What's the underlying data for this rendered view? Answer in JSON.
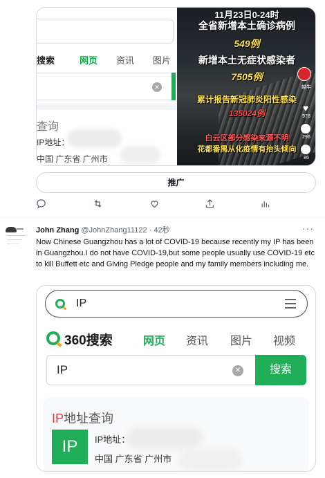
{
  "tweet1": {
    "media_screenshot": {
      "search_tabs": [
        "搜索",
        "网页",
        "资讯",
        "图片"
      ],
      "query_title": "查询",
      "ip_label": "IP地址：",
      "location": "中国  广东省  广州市",
      "clear_icon": "x-circle-icon"
    },
    "media_news": {
      "line1": "11月23日0-24时",
      "line2": "全省新增本土确诊病例",
      "line3": "549例",
      "line4": "新增本土无症状感染者",
      "line5": "7505例",
      "line6": "累计报告新冠肺炎阳性感染",
      "line7": "135024例",
      "line8": "白云区部分感染来源不明",
      "line9": "花都番禺从化疫情有抬头倾向",
      "side_counts": [
        "978",
        "296",
        "86"
      ],
      "tag": "越牛"
    },
    "promote_label": "推广"
  },
  "tweet2": {
    "name": "John Zhang",
    "handle": "@JohnZhang11122",
    "time": "· 42秒",
    "more": "···",
    "text": "Now Chinese Guangzhou has a lot of COVID-19 because recently my IP has been in Guangzhou.I do not have COVID-19,but some people usually use COVID-19 etc to kill Buffett etc and Giving Pledge people and my family members including me.",
    "media": {
      "top_query": "IP",
      "brand": "360搜索",
      "tabs": [
        "网页",
        "资讯",
        "图片",
        "视频"
      ],
      "input_value": "IP",
      "search_button": "搜索",
      "card_title_red": "IP",
      "card_title_rest": "地址查询",
      "badge": "IP",
      "ip_label": "IP地址：",
      "location": "中国  广东省  广州市"
    }
  },
  "colors": {
    "brand_green": "#1fae57",
    "accent_orange": "#f39c12",
    "title_red": "#e23b3b",
    "news_yellow": "#ffe14a",
    "news_red": "#ff4a4a"
  }
}
